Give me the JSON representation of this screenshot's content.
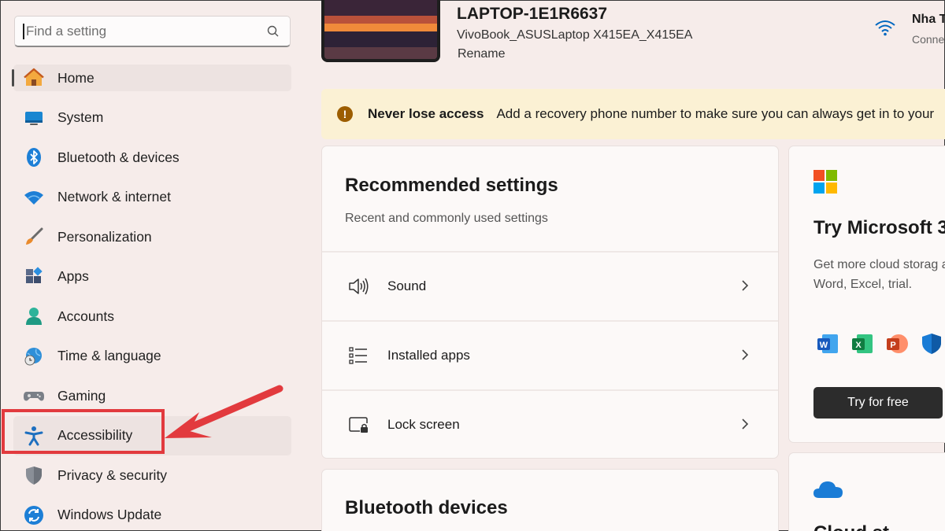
{
  "search": {
    "placeholder": "Find a setting"
  },
  "sidebar": {
    "items": [
      {
        "label": "Home",
        "icon": "home-icon"
      },
      {
        "label": "System",
        "icon": "system-icon"
      },
      {
        "label": "Bluetooth & devices",
        "icon": "bluetooth-icon"
      },
      {
        "label": "Network & internet",
        "icon": "wifi-icon"
      },
      {
        "label": "Personalization",
        "icon": "brush-icon"
      },
      {
        "label": "Apps",
        "icon": "apps-icon"
      },
      {
        "label": "Accounts",
        "icon": "accounts-icon"
      },
      {
        "label": "Time & language",
        "icon": "globe-clock-icon"
      },
      {
        "label": "Gaming",
        "icon": "gamepad-icon"
      },
      {
        "label": "Accessibility",
        "icon": "accessibility-icon"
      },
      {
        "label": "Privacy & security",
        "icon": "shield-icon"
      },
      {
        "label": "Windows Update",
        "icon": "update-icon"
      }
    ]
  },
  "device": {
    "name": "LAPTOP-1E1R6637",
    "model": "VivoBook_ASUSLaptop X415EA_X415EA",
    "rename_label": "Rename"
  },
  "network": {
    "name": "Nha T",
    "status": "Conne"
  },
  "banner": {
    "title": "Never lose access",
    "text": "Add a recovery phone number to make sure you can always get in to your"
  },
  "recommended": {
    "title": "Recommended settings",
    "subtitle": "Recent and commonly used settings",
    "items": [
      {
        "label": "Sound",
        "icon": "speaker-icon"
      },
      {
        "label": "Installed apps",
        "icon": "list-icon"
      },
      {
        "label": "Lock screen",
        "icon": "lock-screen-icon"
      }
    ]
  },
  "bluetooth_card": {
    "title": "Bluetooth devices"
  },
  "m365": {
    "title": "Try Microsoft 3",
    "description": "Get more cloud storag apps like Word, Excel, trial.",
    "button_label": "Try for free",
    "apps": [
      "word-icon",
      "excel-icon",
      "powerpoint-icon",
      "defender-icon"
    ]
  },
  "onedrive": {
    "title": "Cloud st"
  },
  "colors": {
    "background": "#f6ecea",
    "accent": "#0067c0",
    "annotation": "#e23a3e",
    "banner": "#fbf1d4"
  }
}
